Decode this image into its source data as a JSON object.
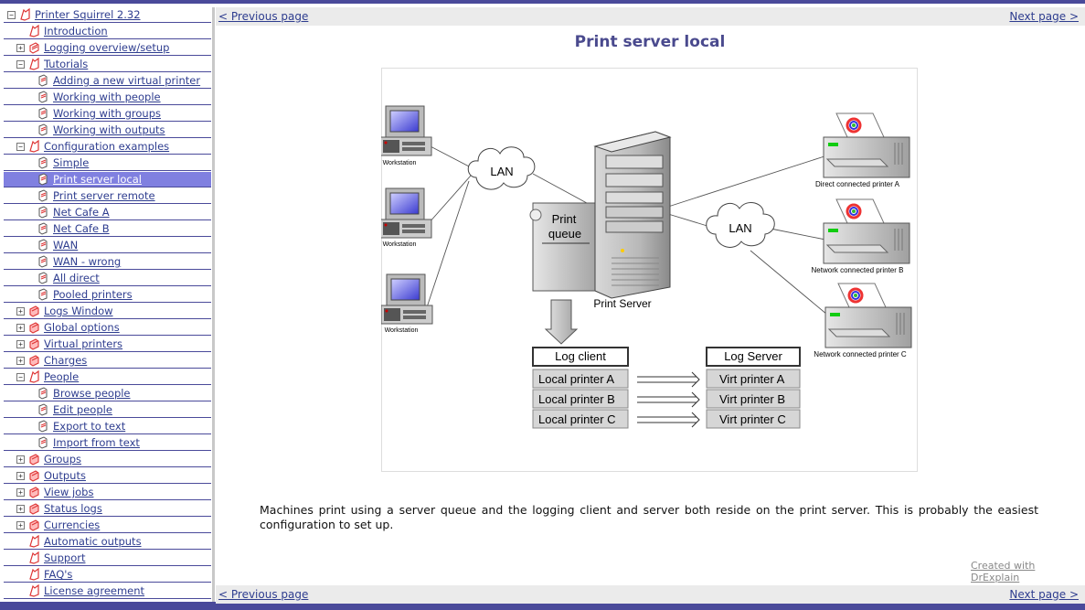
{
  "sidebar": {
    "items": [
      {
        "label": "Printer Squirrel 2.32",
        "level": 0,
        "expander": "minus",
        "icon": "book-open-icon"
      },
      {
        "label": "Introduction",
        "level": 1,
        "expander": "none",
        "icon": "book-open-icon"
      },
      {
        "label": "Logging overview/setup",
        "level": 1,
        "expander": "plus",
        "icon": "book-page-icon"
      },
      {
        "label": "Tutorials",
        "level": 1,
        "expander": "minus",
        "icon": "book-open-icon"
      },
      {
        "label": "Adding a new virtual printer",
        "level": 2,
        "expander": "none",
        "icon": "page-icon"
      },
      {
        "label": "Working with people",
        "level": 2,
        "expander": "none",
        "icon": "page-icon"
      },
      {
        "label": "Working with groups",
        "level": 2,
        "expander": "none",
        "icon": "page-icon"
      },
      {
        "label": "Working with outputs",
        "level": 2,
        "expander": "none",
        "icon": "page-icon"
      },
      {
        "label": "Configuration examples",
        "level": 1,
        "expander": "minus",
        "icon": "book-open-icon"
      },
      {
        "label": "Simple",
        "level": 2,
        "expander": "none",
        "icon": "page-icon"
      },
      {
        "label": "Print server local",
        "level": 2,
        "expander": "none",
        "icon": "page-icon",
        "selected": true
      },
      {
        "label": "Print server remote",
        "level": 2,
        "expander": "none",
        "icon": "page-icon"
      },
      {
        "label": "Net Cafe A",
        "level": 2,
        "expander": "none",
        "icon": "page-icon"
      },
      {
        "label": "Net Cafe B",
        "level": 2,
        "expander": "none",
        "icon": "page-icon"
      },
      {
        "label": "WAN",
        "level": 2,
        "expander": "none",
        "icon": "page-icon"
      },
      {
        "label": "WAN - wrong",
        "level": 2,
        "expander": "none",
        "icon": "page-icon"
      },
      {
        "label": "All direct",
        "level": 2,
        "expander": "none",
        "icon": "page-icon"
      },
      {
        "label": "Pooled printers",
        "level": 2,
        "expander": "none",
        "icon": "page-icon"
      },
      {
        "label": "Logs Window",
        "level": 1,
        "expander": "plus",
        "icon": "book-closed-icon"
      },
      {
        "label": "Global options",
        "level": 1,
        "expander": "plus",
        "icon": "book-closed-icon"
      },
      {
        "label": "Virtual printers",
        "level": 1,
        "expander": "plus",
        "icon": "book-closed-icon"
      },
      {
        "label": "Charges",
        "level": 1,
        "expander": "plus",
        "icon": "book-closed-icon"
      },
      {
        "label": "People",
        "level": 1,
        "expander": "minus",
        "icon": "book-open-icon"
      },
      {
        "label": "Browse people",
        "level": 2,
        "expander": "none",
        "icon": "page-icon"
      },
      {
        "label": "Edit people",
        "level": 2,
        "expander": "none",
        "icon": "page-icon"
      },
      {
        "label": "Export to text",
        "level": 2,
        "expander": "none",
        "icon": "page-icon"
      },
      {
        "label": "Import from text",
        "level": 2,
        "expander": "none",
        "icon": "page-icon"
      },
      {
        "label": "Groups",
        "level": 1,
        "expander": "plus",
        "icon": "book-closed-icon"
      },
      {
        "label": "Outputs",
        "level": 1,
        "expander": "plus",
        "icon": "book-closed-icon"
      },
      {
        "label": "View jobs",
        "level": 1,
        "expander": "plus",
        "icon": "book-closed-icon"
      },
      {
        "label": "Status logs",
        "level": 1,
        "expander": "plus",
        "icon": "book-closed-icon"
      },
      {
        "label": "Currencies",
        "level": 1,
        "expander": "plus",
        "icon": "book-closed-icon"
      },
      {
        "label": "Automatic outputs",
        "level": 1,
        "expander": "none",
        "icon": "book-open-icon"
      },
      {
        "label": "Support",
        "level": 1,
        "expander": "none",
        "icon": "book-open-icon"
      },
      {
        "label": "FAQ's",
        "level": 1,
        "expander": "none",
        "icon": "book-open-icon"
      },
      {
        "label": "License agreement",
        "level": 1,
        "expander": "none",
        "icon": "book-open-icon"
      }
    ]
  },
  "nav": {
    "prev": "< Previous page",
    "next": "Next page >"
  },
  "page": {
    "title": "Print server local",
    "body": "Machines print using a server queue and the logging client and server both reside on the print server. This is probably the easiest configuration to set up.",
    "credit": "Created with DrExplain"
  },
  "diagram": {
    "workstation_label": "Workstation",
    "lan_label": "LAN",
    "print_queue_label": "Print queue",
    "print_server_label": "Print Server",
    "printer_a_label": "Direct connected printer A",
    "printer_b_label": "Network connected printer B",
    "printer_c_label": "Network connected printer C",
    "log_client_title": "Log client",
    "log_server_title": "Log Server",
    "local_printers": [
      "Local printer A",
      "Local printer B",
      "Local printer C"
    ],
    "virtual_printers": [
      "Virt printer A",
      "Virt printer B",
      "Virt printer C"
    ]
  },
  "colors": {
    "link": "#2e3d8f",
    "selected_row": "#8080e0",
    "frame": "#4a4a9a",
    "title": "#4a4a8e"
  }
}
